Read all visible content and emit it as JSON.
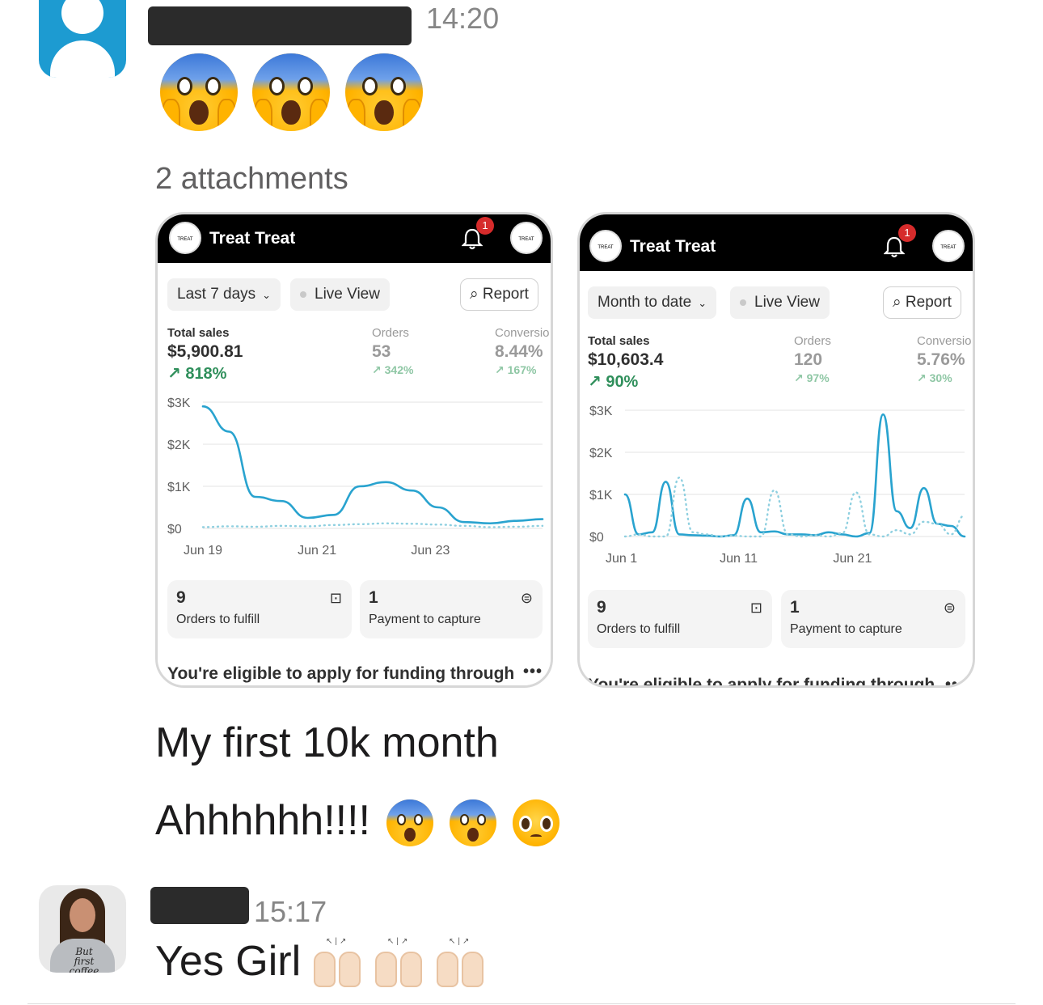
{
  "messages": [
    {
      "time": "14:20",
      "emojis": [
        "face-screaming-in-fear",
        "face-screaming-in-fear",
        "face-screaming-in-fear"
      ],
      "attachments_label": "2 attachments",
      "text_lines": [
        "My first 10k month",
        "Ahhhhhh!!!!"
      ],
      "trailing_emojis": [
        "face-screaming-in-fear",
        "face-screaming-in-fear",
        "pleading-face"
      ]
    },
    {
      "time": "15:17",
      "text": "Yes Girl",
      "trailing_emojis": [
        "raising-hands",
        "raising-hands",
        "raising-hands"
      ],
      "avatar_shirt_text": "But first coffee"
    }
  ],
  "screenshots": [
    {
      "store_name": "Treat Treat",
      "logo_text": "TREAT TREAT",
      "notification_count": "1",
      "date_range": "Last 7 days",
      "live_view": "Live View",
      "report": "Report",
      "total_sales_label": "Total sales",
      "total_sales_value": "$5,900.81",
      "total_sales_delta": "↗ 818%",
      "orders_label": "Orders",
      "orders_value": "53",
      "orders_delta": "↗ 342%",
      "conversion_label": "Conversio",
      "conversion_value": "8.44%",
      "conversion_delta": "↗ 167%",
      "card1_num": "9",
      "card1_label": "Orders to fulfill",
      "card2_num": "1",
      "card2_label": "Payment to capture",
      "funding_text": "You're eligible to apply for funding through"
    },
    {
      "store_name": "Treat Treat",
      "logo_text": "TREAT TREAT",
      "notification_count": "1",
      "date_range": "Month to date",
      "live_view": "Live View",
      "report": "Report",
      "total_sales_label": "Total sales",
      "total_sales_value": "$10,603.4",
      "total_sales_delta": "↗ 90%",
      "orders_label": "Orders",
      "orders_value": "120",
      "orders_delta": "↗ 97%",
      "conversion_label": "Conversio",
      "conversion_value": "5.76%",
      "conversion_delta": "↗ 30%",
      "card1_num": "9",
      "card1_label": "Orders to fulfill",
      "card2_num": "1",
      "card2_label": "Payment to capture",
      "funding_text": "You're eligible to apply for funding through"
    }
  ],
  "chart_data": [
    {
      "type": "line",
      "y_ticks": [
        "$3K",
        "$2K",
        "$1K",
        "$0"
      ],
      "ylim": [
        0,
        3000
      ],
      "x_ticks": [
        "Jun 19",
        "Jun 21",
        "Jun 23"
      ],
      "x": [
        0,
        0.5,
        1,
        1.5,
        2,
        2.5,
        3,
        3.5,
        4,
        4.5,
        5,
        5.5,
        6,
        6.5
      ],
      "series": [
        {
          "style": "solid",
          "color": "#29a3cf",
          "values": [
            2900,
            2300,
            750,
            650,
            250,
            320,
            1000,
            1100,
            900,
            500,
            150,
            120,
            180,
            220
          ]
        },
        {
          "style": "dotted",
          "color": "#8fd0e0",
          "values": [
            30,
            50,
            40,
            60,
            50,
            80,
            100,
            120,
            110,
            90,
            60,
            30,
            40,
            60
          ]
        }
      ],
      "colors": {
        "primary": "#29a3cf",
        "comparison": "#8fd0e0"
      }
    },
    {
      "type": "line",
      "y_ticks": [
        "$3K",
        "$2K",
        "$1K",
        "$0"
      ],
      "ylim": [
        0,
        3000
      ],
      "x_ticks": [
        "Jun 1",
        "Jun 11",
        "Jun 21"
      ],
      "x": [
        0,
        1,
        2,
        3,
        4,
        5,
        6,
        7,
        8,
        9,
        10,
        11,
        12,
        13,
        14,
        15,
        16,
        17,
        18,
        19,
        20,
        21,
        22,
        23,
        24,
        25
      ],
      "series": [
        {
          "style": "solid",
          "color": "#29a3cf",
          "values": [
            1000,
            50,
            100,
            1300,
            50,
            30,
            20,
            0,
            30,
            900,
            100,
            120,
            50,
            50,
            30,
            100,
            50,
            0,
            80,
            2900,
            600,
            200,
            1150,
            300,
            250,
            0
          ]
        },
        {
          "style": "dotted",
          "color": "#8fd0e0",
          "values": [
            0,
            50,
            0,
            0,
            1400,
            100,
            50,
            0,
            20,
            0,
            0,
            1100,
            50,
            0,
            30,
            0,
            80,
            1050,
            50,
            0,
            150,
            50,
            350,
            300,
            50,
            500
          ]
        }
      ],
      "colors": {
        "primary": "#29a3cf",
        "comparison": "#8fd0e0"
      }
    }
  ]
}
